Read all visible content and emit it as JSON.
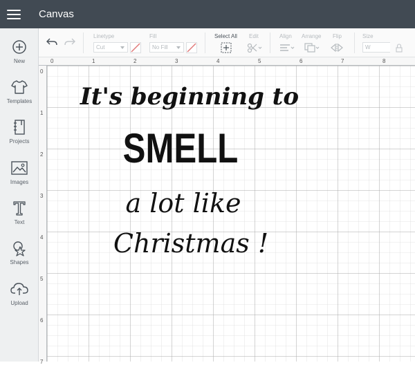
{
  "app": {
    "title": "Canvas"
  },
  "sidebar": {
    "items": [
      {
        "label": "New",
        "icon": "plus-circle-icon"
      },
      {
        "label": "Templates",
        "icon": "tshirt-icon"
      },
      {
        "label": "Projects",
        "icon": "notebook-icon"
      },
      {
        "label": "Images",
        "icon": "image-icon"
      },
      {
        "label": "Text",
        "icon": "text-t-icon"
      },
      {
        "label": "Shapes",
        "icon": "shapes-icon"
      },
      {
        "label": "Upload",
        "icon": "cloud-upload-icon"
      }
    ]
  },
  "toolbar": {
    "linetype_label": "Linetype",
    "linetype_value": "Cut",
    "fill_label": "Fill",
    "fill_value": "No Fill",
    "select_all_label": "Select All",
    "edit_label": "Edit",
    "align_label": "Align",
    "arrange_label": "Arrange",
    "flip_label": "Flip",
    "size_label": "Size",
    "size_w_label": "W"
  },
  "ruler": {
    "h": [
      "0",
      "1",
      "2",
      "3",
      "4",
      "5",
      "6",
      "7",
      "8"
    ],
    "v": [
      "0",
      "1",
      "2",
      "3",
      "4",
      "5",
      "6",
      "7"
    ]
  },
  "design": {
    "line1": "It's beginning to",
    "line2": "SMELL",
    "line3": "a lot like",
    "line4": "Christmas !"
  }
}
